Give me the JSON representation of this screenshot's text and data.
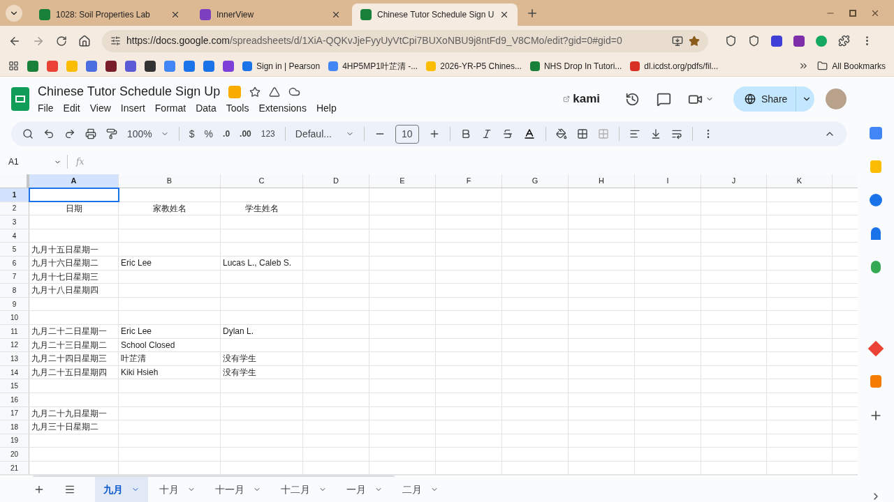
{
  "browser": {
    "tabs": [
      {
        "title": "1028: Soil Properties Lab",
        "selected": false,
        "color": "#188038"
      },
      {
        "title": "InnerView",
        "selected": false,
        "color": "#7b3fbf"
      },
      {
        "title": "Chinese Tutor Schedule Sign U",
        "selected": true,
        "color": "#188038"
      }
    ],
    "url": {
      "host": "https://docs.google.com",
      "path": "/spreadsheets/d/1XiA-QQKvJjeFyyUyVtCpi7BUXoNBU9j8ntFd9_V8CMo/edit?gid=0#gid=0"
    },
    "bookmarks": [
      {
        "label": "Sign in | Pearson",
        "color": "#1a73e8"
      },
      {
        "label": "4HP5MP1叶芷清 -...",
        "color": "#4285f4"
      },
      {
        "label": "2026-YR-P5 Chines...",
        "color": "#fbbc04"
      },
      {
        "label": "NHS Drop In Tutori...",
        "color": "#188038"
      },
      {
        "label": "dl.icdst.org/pdfs/fil...",
        "color": "#d93025"
      }
    ],
    "all_bookmarks": "All Bookmarks"
  },
  "doc": {
    "title": "Chinese Tutor Schedule Sign Up",
    "menus": [
      "File",
      "Edit",
      "View",
      "Insert",
      "Format",
      "Data",
      "Tools",
      "Extensions",
      "Help"
    ],
    "kami": "kami",
    "share": "Share"
  },
  "toolbar": {
    "zoom": "100%",
    "currency": "$",
    "percent": "%",
    "decrease_decimal": ".0",
    "increase_decimal": ".00",
    "number_format": "123",
    "font": "Defaul...",
    "font_size": "10"
  },
  "formula_bar": {
    "name_box": "A1",
    "fx": "fx"
  },
  "columns": [
    {
      "label": "A",
      "selected": true
    },
    {
      "label": "B",
      "selected": false
    },
    {
      "label": "C",
      "selected": false
    },
    {
      "label": "D",
      "selected": false
    },
    {
      "label": "E",
      "selected": false
    },
    {
      "label": "F",
      "selected": false
    },
    {
      "label": "G",
      "selected": false
    },
    {
      "label": "H",
      "selected": false
    },
    {
      "label": "I",
      "selected": false
    },
    {
      "label": "J",
      "selected": false
    },
    {
      "label": "K",
      "selected": false
    }
  ],
  "rows": [
    {
      "number": "1",
      "selected": true
    },
    {
      "number": "2",
      "selected": false,
      "kind": "header",
      "a": "日期",
      "b": "家教姓名",
      "c": "学生姓名"
    },
    {
      "number": "3",
      "selected": false
    },
    {
      "number": "4",
      "selected": false
    },
    {
      "number": "5",
      "selected": false,
      "a": "九月十五日星期一"
    },
    {
      "number": "6",
      "selected": false,
      "a": "九月十六日星期二",
      "b": "Eric Lee",
      "c": "Lucas L., Caleb S."
    },
    {
      "number": "7",
      "selected": false,
      "a": "九月十七日星期三"
    },
    {
      "number": "8",
      "selected": false,
      "a": "九月十八日星期四"
    },
    {
      "number": "9",
      "selected": false
    },
    {
      "number": "10",
      "selected": false
    },
    {
      "number": "11",
      "selected": false,
      "a": "九月二十二日星期一",
      "b": "Eric Lee",
      "c": "Dylan L."
    },
    {
      "number": "12",
      "selected": false,
      "a": "九月二十三日星期二",
      "b": "School Closed"
    },
    {
      "number": "13",
      "selected": false,
      "a": "九月二十四日星期三",
      "b": "叶芷清",
      "c": "没有学生"
    },
    {
      "number": "14",
      "selected": false,
      "a": "九月二十五日星期四",
      "b": "Kiki Hsieh",
      "c": "没有学生"
    },
    {
      "number": "15",
      "selected": false
    },
    {
      "number": "16",
      "selected": false
    },
    {
      "number": "17",
      "selected": false,
      "a": "九月二十九日星期一"
    },
    {
      "number": "18",
      "selected": false,
      "a": "九月三十日星期二"
    },
    {
      "number": "19",
      "selected": false
    },
    {
      "number": "20",
      "selected": false
    },
    {
      "number": "21",
      "selected": false
    }
  ],
  "sheets": [
    {
      "name": "九月",
      "selected": true
    },
    {
      "name": "十月",
      "selected": false
    },
    {
      "name": "十一月",
      "selected": false
    },
    {
      "name": "十二月",
      "selected": false
    },
    {
      "name": "一月",
      "selected": false
    },
    {
      "name": "二月",
      "selected": false
    }
  ]
}
